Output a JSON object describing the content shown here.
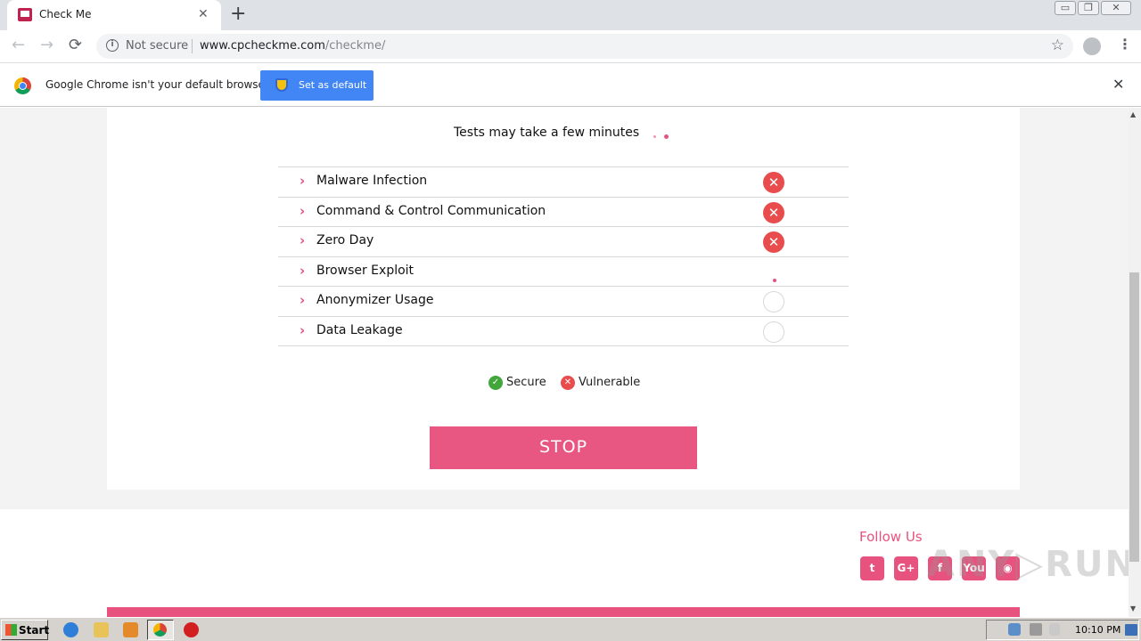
{
  "browser": {
    "tab_title": "Check Me",
    "tab_close": "✕",
    "new_tab": "+",
    "window_controls": [
      "▭",
      "❐",
      "✕"
    ],
    "security_label": "Not secure",
    "url_host": "www.cpcheckme.com",
    "url_path": "/checkme/",
    "back": "←",
    "forward": "→",
    "reload": "⟳",
    "star": "☆",
    "menu": "⋮"
  },
  "infobar": {
    "message": "Google Chrome isn't your default browser",
    "button_label": "Set as default",
    "close": "✕"
  },
  "page": {
    "subtitle": "Tests may take a few minutes",
    "tests": [
      {
        "name": "Malware Infection",
        "status": "vulnerable"
      },
      {
        "name": "Command & Control Communication",
        "status": "vulnerable"
      },
      {
        "name": "Zero Day",
        "status": "vulnerable"
      },
      {
        "name": "Browser Exploit",
        "status": "running"
      },
      {
        "name": "Anonymizer Usage",
        "status": "pending"
      },
      {
        "name": "Data Leakage",
        "status": "pending"
      }
    ],
    "legend": {
      "secure": "Secure",
      "vulnerable": "Vulnerable"
    },
    "stop_label": "STOP",
    "follow_us": "Follow Us",
    "social": [
      {
        "icon": "twitter-icon",
        "glyph": "t"
      },
      {
        "icon": "google-plus-icon",
        "glyph": "G+"
      },
      {
        "icon": "facebook-icon",
        "glyph": "f"
      },
      {
        "icon": "youtube-icon",
        "glyph": "You"
      },
      {
        "icon": "rss-icon",
        "glyph": "◉"
      }
    ],
    "watermark": "ANY▷RUN",
    "accent_color": "#e8527e",
    "vulnerable_color": "#e84c4c",
    "secure_color": "#43a63a"
  },
  "taskbar": {
    "start_label": "Start",
    "clock": "10:10 PM"
  }
}
